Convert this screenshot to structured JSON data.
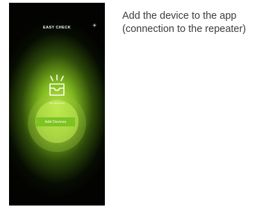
{
  "app": {
    "title": "EASY CHECK",
    "add_icon": "plus-icon"
  },
  "empty_state": {
    "icon": "empty-tray-icon",
    "status_text": "No devices",
    "button_label": "Add Devices"
  },
  "caption": {
    "text": "Add the device to the app (connection to the repeater)"
  },
  "colors": {
    "phone_background": "#030402",
    "glow": "#c8f04a",
    "button": "#7dc421",
    "caption_text": "#3b3b3b"
  }
}
